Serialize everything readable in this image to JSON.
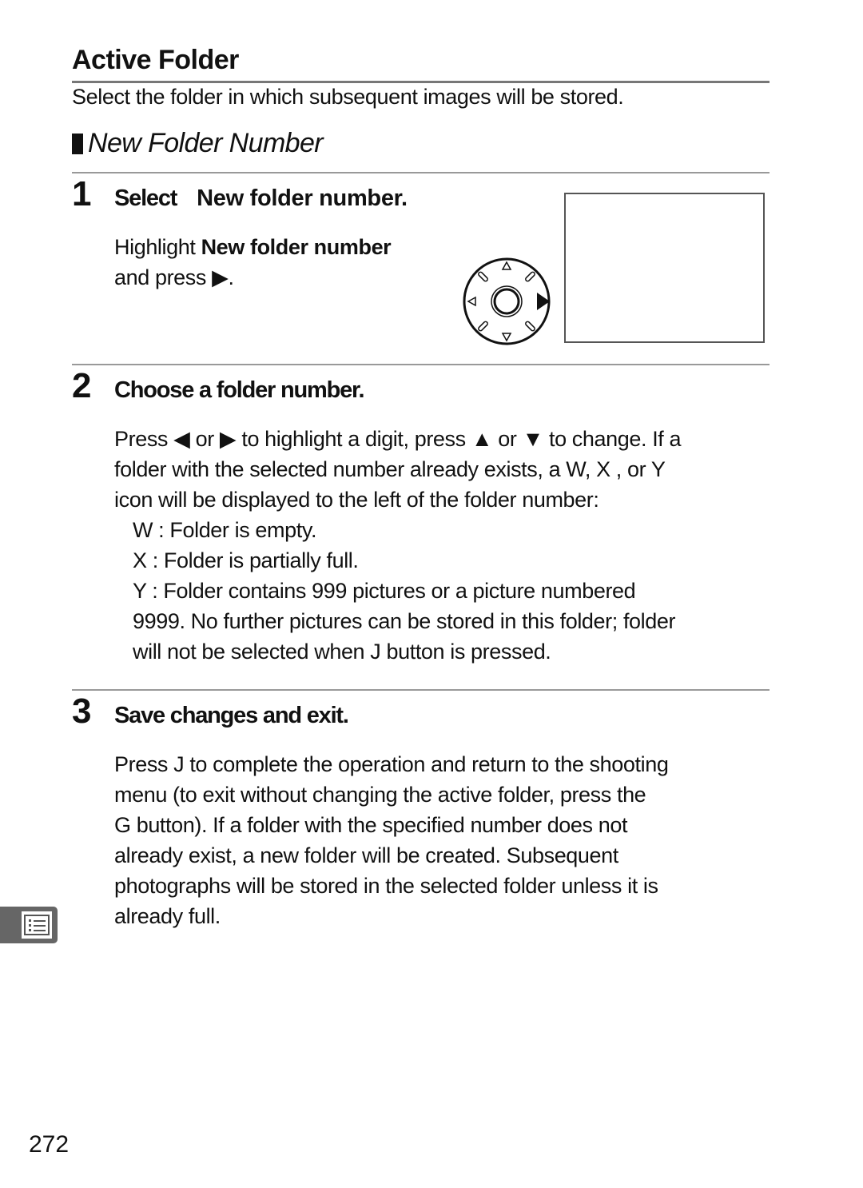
{
  "page": {
    "title": "Active Folder",
    "intro": "Select the folder in which subsequent images will be stored.",
    "subheading": "New Folder Number",
    "page_number": "272"
  },
  "steps": [
    {
      "number": "1",
      "title_prefix": "Select",
      "title_bold": "New folder number.",
      "text_prefix": "Highlight ",
      "text_bold": "New folder number",
      "text_line2": "and press ▶."
    },
    {
      "number": "2",
      "title": "Choose a folder number.",
      "lines": [
        "Press ◀ or ▶ to highlight a digit, press ▲ or ▼ to change.  If a",
        "folder with the selected number already exists, a W, X , or Y",
        "icon will be displayed to the left of the folder number:"
      ],
      "legend": [
        "W : Folder is empty.",
        "X  : Folder is partially full.",
        "Y  : Folder contains 999 pictures or a picture numbered",
        "9999.  No further pictures can be stored in this folder; folder",
        "will not be selected when J   button is pressed."
      ]
    },
    {
      "number": "3",
      "title": "Save changes and exit.",
      "lines": [
        "Press J   to complete the operation and return to the shooting",
        "menu (to exit without changing the active folder, press the",
        "G     button).  If a folder with the specified number does not",
        "already exist, a new folder will be created.  Subsequent",
        "photographs will be stored in the selected folder unless it is",
        "already full."
      ]
    }
  ],
  "icons": {
    "multi_selector": "multi-selector-right-icon",
    "side_tab": "shooting-menu-list-icon"
  }
}
